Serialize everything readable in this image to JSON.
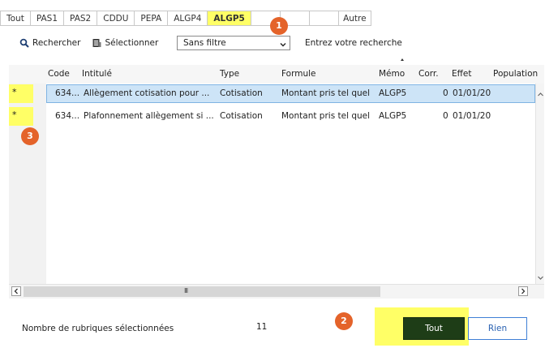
{
  "tabs": [
    {
      "label": "Tout",
      "active": false
    },
    {
      "label": "PAS1",
      "active": false
    },
    {
      "label": "PAS2",
      "active": false
    },
    {
      "label": "CDDU",
      "active": false
    },
    {
      "label": "PEPA",
      "active": false
    },
    {
      "label": "ALGP4",
      "active": false
    },
    {
      "label": "ALGP5",
      "active": true
    },
    {
      "label": "",
      "active": false
    },
    {
      "label": "",
      "active": false
    },
    {
      "label": "",
      "active": false
    },
    {
      "label": "Autre",
      "active": false
    }
  ],
  "toolbar": {
    "search_label": "Rechercher",
    "search_icon": "search-icon",
    "select_label": "Sélectionner",
    "select_icon": "select-icon",
    "filter_value": "Sans filtre",
    "search_placeholder": "Entrez votre recherche"
  },
  "table": {
    "columns": [
      "Code",
      "Intitulé",
      "Type",
      "Formule",
      "Mémo",
      "Corr.",
      "Effet",
      "Population"
    ],
    "rows": [
      {
        "marker": "*",
        "code": "634...",
        "intitule": "Allègement cotisation pour ...",
        "type": "Cotisation",
        "formule": "Montant pris tel quel",
        "memo": "ALGP5",
        "corr": "0",
        "effet": "01/01/20",
        "population": "",
        "selected": true
      },
      {
        "marker": "*",
        "code": "634...",
        "intitule": "Plafonnement allègement si ...",
        "type": "Cotisation",
        "formule": "Montant pris tel quel",
        "memo": "ALGP5",
        "corr": "0",
        "effet": "01/01/20",
        "population": "",
        "selected": false
      }
    ]
  },
  "footer": {
    "count_label": "Nombre de rubriques sélectionnées",
    "count_value": "11",
    "tout_label": "Tout",
    "rien_label": "Rien"
  },
  "annotations": [
    "1",
    "2",
    "3"
  ],
  "colors": {
    "highlight": "#ffff66",
    "badge": "#e4632a",
    "selected_row": "#cde4f7",
    "tout_button": "#1e3d17",
    "rien_border": "#3f7fd6"
  }
}
